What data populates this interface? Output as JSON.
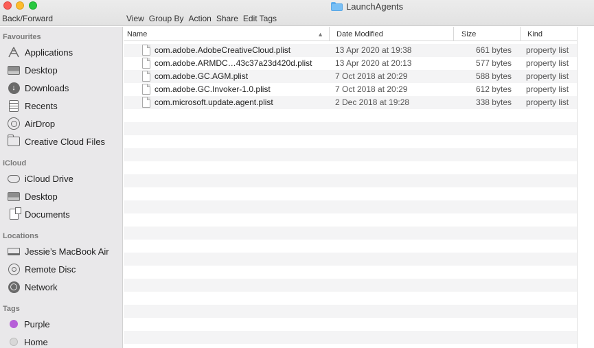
{
  "window": {
    "title": "LaunchAgents",
    "nav_label": "Back/Forward",
    "toolbar": [
      "View",
      "Group By",
      "Action",
      "Share",
      "Edit Tags"
    ]
  },
  "sidebar": {
    "favourites_heading": "Favourites",
    "favourites": [
      {
        "label": "Applications",
        "icon": "applications-icon"
      },
      {
        "label": "Desktop",
        "icon": "desktop-icon"
      },
      {
        "label": "Downloads",
        "icon": "downloads-icon"
      },
      {
        "label": "Recents",
        "icon": "recents-icon"
      },
      {
        "label": "AirDrop",
        "icon": "airdrop-icon"
      },
      {
        "label": "Creative Cloud Files",
        "icon": "folder-icon"
      }
    ],
    "icloud_heading": "iCloud",
    "icloud": [
      {
        "label": "iCloud Drive",
        "icon": "cloud-icon"
      },
      {
        "label": "Desktop",
        "icon": "desktop-icon"
      },
      {
        "label": "Documents",
        "icon": "documents-icon"
      }
    ],
    "locations_heading": "Locations",
    "locations": [
      {
        "label": "Jessie’s MacBook Air",
        "icon": "laptop-icon"
      },
      {
        "label": "Remote Disc",
        "icon": "disc-icon"
      },
      {
        "label": "Network",
        "icon": "network-icon"
      }
    ],
    "tags_heading": "Tags",
    "tags": [
      {
        "label": "Purple",
        "color": "#b65fd8"
      },
      {
        "label": "Home",
        "color": "#d8d8d8"
      }
    ]
  },
  "list": {
    "columns": {
      "name": "Name",
      "date": "Date Modified",
      "size": "Size",
      "kind": "Kind"
    },
    "files": [
      {
        "name": "com.adobe.AdobeCreativeCloud.plist",
        "date": "13 Apr 2020 at 19:38",
        "size": "661 bytes",
        "kind": "property list"
      },
      {
        "name": "com.adobe.ARMDC…43c37a23d420d.plist",
        "date": "13 Apr 2020 at 20:13",
        "size": "577 bytes",
        "kind": "property list"
      },
      {
        "name": "com.adobe.GC.AGM.plist",
        "date": "7 Oct 2018 at 20:29",
        "size": "588 bytes",
        "kind": "property list"
      },
      {
        "name": "com.adobe.GC.Invoker-1.0.plist",
        "date": "7 Oct 2018 at 20:29",
        "size": "612 bytes",
        "kind": "property list"
      },
      {
        "name": "com.microsoft.update.agent.plist",
        "date": "2 Dec 2018 at 19:28",
        "size": "338 bytes",
        "kind": "property list"
      }
    ]
  }
}
